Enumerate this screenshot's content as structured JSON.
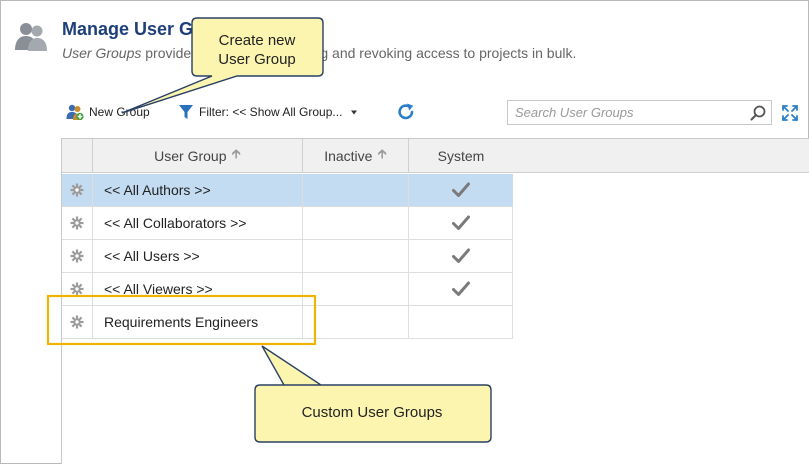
{
  "header": {
    "title": "Manage User Groups",
    "subtitle_italic": "User Groups",
    "subtitle_rest": " provide a method for granting and revoking access to projects in bulk.",
    "icon": "users-icon"
  },
  "toolbar": {
    "new_group_label": "New Group",
    "filter_label": "Filter: << Show All Group...",
    "search_placeholder": "Search User Groups",
    "search_value": ""
  },
  "grid": {
    "columns": {
      "user_group": "User Group",
      "inactive": "Inactive",
      "system": "System"
    },
    "rows": [
      {
        "name": "<< All Authors >>",
        "inactive": false,
        "system": true,
        "selected": true
      },
      {
        "name": "<< All Collaborators >>",
        "inactive": false,
        "system": true,
        "selected": false
      },
      {
        "name": "<< All Users >>",
        "inactive": false,
        "system": true,
        "selected": false
      },
      {
        "name": "<< All Viewers >>",
        "inactive": false,
        "system": true,
        "selected": false
      },
      {
        "name": "Requirements Engineers",
        "inactive": false,
        "system": false,
        "selected": false
      }
    ]
  },
  "callouts": {
    "new_group": [
      "Create new",
      "User Group"
    ],
    "custom_groups": "Custom User Groups"
  },
  "colors": {
    "title": "#1f3f7a",
    "selected_row": "#c4dcf2",
    "callout_fill": "#fcf5b0",
    "callout_border": "#2a4064",
    "highlight_box": "#f0b400",
    "accent": "#2a7fc7"
  }
}
